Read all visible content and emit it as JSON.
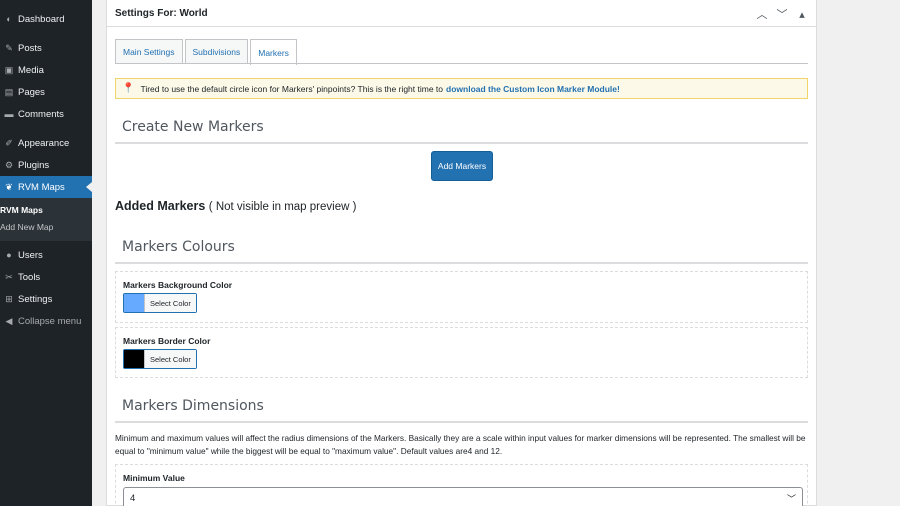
{
  "sidebar": {
    "items": [
      {
        "label": "Dashboard",
        "icon": "dashboard-icon"
      },
      {
        "label": "Posts",
        "icon": "pin-icon"
      },
      {
        "label": "Media",
        "icon": "media-icon"
      },
      {
        "label": "Pages",
        "icon": "page-icon"
      },
      {
        "label": "Comments",
        "icon": "comment-icon"
      },
      {
        "label": "Appearance",
        "icon": "brush-icon"
      },
      {
        "label": "Plugins",
        "icon": "plugin-icon"
      },
      {
        "label": "RVM Maps",
        "icon": "map-icon"
      },
      {
        "label": "Users",
        "icon": "users-icon"
      },
      {
        "label": "Tools",
        "icon": "wrench-icon"
      },
      {
        "label": "Settings",
        "icon": "settings-icon"
      },
      {
        "label": "Collapse menu",
        "icon": "collapse-icon"
      }
    ],
    "submenu": [
      "RVM Maps",
      "Add New Map"
    ]
  },
  "panel": {
    "title": "Settings For: World"
  },
  "tabs": [
    "Main Settings",
    "Subdivisions",
    "Markers"
  ],
  "notice": {
    "text": "Tired to use the default circle icon for Markers' pinpoints? This is the right time to",
    "link": "download the Custom Icon Marker Module!"
  },
  "create_markers": {
    "title": "Create New Markers",
    "button": "Add Markers"
  },
  "added_markers": {
    "title": "Added Markers",
    "note": "( Not visible in map preview )"
  },
  "colours": {
    "title": "Markers Colours",
    "background_label": "Markers Background Color",
    "background_color": "#66aaff",
    "border_label": "Markers Border Color",
    "border_color": "#000000",
    "picker_text": "Select Color"
  },
  "dimensions": {
    "title": "Markers Dimensions",
    "description": "Minimum and maximum values will affect the radius dimensions of the Markers. Basically they are a scale within input values for marker dimensions will be represented. The smallest will be equal to \"minimum value\" while the biggest will be equal to \"maximum value\". Default values are4 and 12.",
    "min_label": "Minimum Value",
    "min_value": "4"
  }
}
